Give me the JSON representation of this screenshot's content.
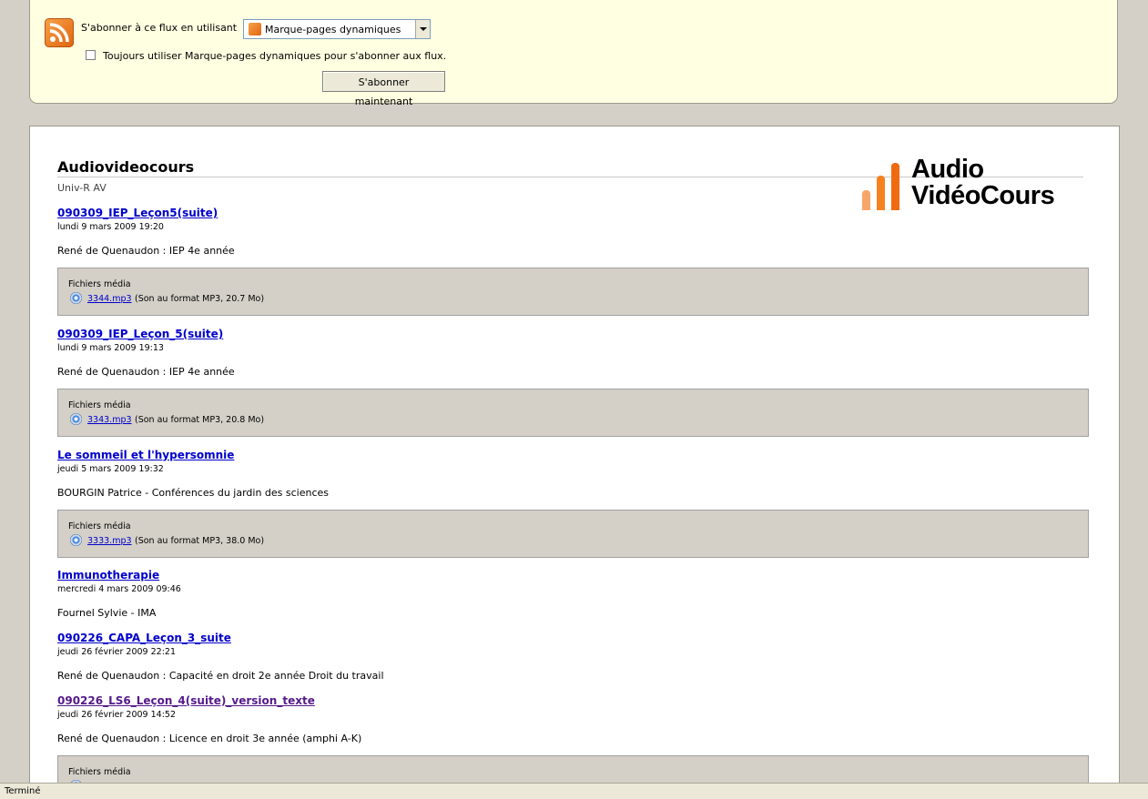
{
  "subscribe": {
    "label": "S'abonner à ce flux en utilisant",
    "reader": "Marque-pages dynamiques",
    "always_label": "Toujours utiliser Marque-pages dynamiques pour s'abonner aux flux.",
    "always_checked": false,
    "button": "S'abonner maintenant"
  },
  "feed": {
    "title": "Audiovideocours",
    "subtitle": "Univ-R AV",
    "logo_line1": "Audio",
    "logo_line2": "VidéoCours",
    "media_heading": "Fichiers média",
    "entries": [
      {
        "title": "090309_IEP_Leçon5(suite)",
        "date": "lundi 9 mars 2009 19:20",
        "desc": "René de Quenaudon : IEP 4e année",
        "file": "3344.mp3",
        "info": "(Son au format MP3, 20.7 Mo)"
      },
      {
        "title": "090309_IEP_Leçon_5(suite)",
        "date": "lundi 9 mars 2009 19:13",
        "desc": "René de Quenaudon : IEP 4e année",
        "file": "3343.mp3",
        "info": "(Son au format MP3, 20.8 Mo)"
      },
      {
        "title": "Le sommeil et l'hypersomnie",
        "date": "jeudi 5 mars 2009 19:32",
        "desc": "BOURGIN Patrice - Conférences du jardin des sciences",
        "file": "3333.mp3",
        "info": "(Son au format MP3, 38.0 Mo)"
      },
      {
        "title": "Immunotherapie",
        "date": "mercredi 4 mars 2009 09:46",
        "desc": "Fournel Sylvie - IMA"
      },
      {
        "title": "090226_CAPA_Leçon_3_suite",
        "date": "jeudi 26 février 2009 22:21",
        "desc": "René de Quenaudon : Capacité en droit 2e année Droit du travail"
      },
      {
        "title": "090226_LS6_Leçon_4(suite)_version_texte",
        "date": "jeudi 26 février 2009 14:52",
        "desc": "René de Quenaudon : Licence en droit 3e année (amphi A-K)",
        "visited": true
      }
    ]
  },
  "status": {
    "text": "Terminé"
  },
  "colors": {
    "subscribe_bg": "#ffffe1",
    "link": "#0000cc",
    "visited": "#551a8b",
    "media_bg": "#d4d0c8",
    "logo_orange": "#f58220"
  },
  "icons": {
    "feed": "rss-feed-icon",
    "audio": "audio-file-icon",
    "dropdown": "chevron-down-icon"
  }
}
